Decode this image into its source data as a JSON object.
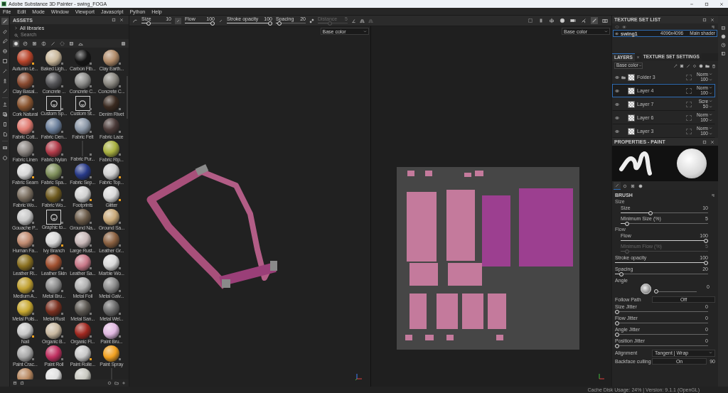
{
  "window": {
    "title": "Adobe Substance 3D Painter - swing_FOGA"
  },
  "menu": [
    "File",
    "Edit",
    "Mode",
    "Window",
    "Viewport",
    "Javascript",
    "Python",
    "Help"
  ],
  "tools": [
    {
      "selected": true
    },
    {
      "selected": false
    },
    {
      "selected": false
    },
    {
      "selected": false
    },
    {
      "selected": false
    },
    {
      "selected": false
    },
    {
      "selected": false
    },
    {
      "selected": false
    },
    {
      "selected": false
    },
    {
      "selected": false
    },
    {
      "selected": false
    },
    {
      "selected": false
    },
    {
      "selected": false
    },
    {
      "selected": false
    }
  ],
  "assets": {
    "title": "ASSETS",
    "library": "All libraries",
    "search_placeholder": "Search",
    "filters": [
      {
        "selected": true
      },
      {
        "selected": false
      },
      {
        "selected": false
      },
      {
        "selected": false
      },
      {
        "selected": false
      },
      {
        "selected": false
      },
      {
        "selected": false
      },
      {
        "selected": false
      }
    ],
    "items": [
      {
        "kind": "sphere",
        "label": "Autumn Le...",
        "color": "#b8442a",
        "smart": true
      },
      {
        "kind": "sphere",
        "label": "Baked Ligh...",
        "color": "#c9b79a",
        "smart": false
      },
      {
        "kind": "sphere",
        "label": "Carbon Fib...",
        "color": "#151515",
        "smart": false
      },
      {
        "kind": "sphere",
        "label": "Clay Earth...",
        "color": "#b08a68",
        "smart": false
      },
      {
        "kind": "sphere",
        "label": "Clay Basal...",
        "color": "#8a4a30",
        "smart": false
      },
      {
        "kind": "sphere",
        "label": "Concrete ...",
        "color": "#555558",
        "smart": false
      },
      {
        "kind": "sphere",
        "label": "Concrete C...",
        "color": "#8c8c8a",
        "smart": false
      },
      {
        "kind": "sphere",
        "label": "Concrete C...",
        "color": "#8a8780",
        "smart": false
      },
      {
        "kind": "sphere",
        "label": "Cork Natural",
        "color": "#8a5530",
        "smart": false
      },
      {
        "kind": "stencil",
        "label": "Custom Sp...",
        "color": "#d0d0d0",
        "smart": false
      },
      {
        "kind": "stencil",
        "label": "Custom St...",
        "color": "#d0d0d0",
        "smart": false
      },
      {
        "kind": "sphere",
        "label": "Denim Rivet",
        "color": "#3a2a20",
        "smart": false
      },
      {
        "kind": "sphere",
        "label": "Fabric Cott...",
        "color": "#e07a70",
        "smart": false
      },
      {
        "kind": "sphere",
        "label": "Fabric Den...",
        "color": "#6a7e9a",
        "smart": false
      },
      {
        "kind": "sphere",
        "label": "Fabric Felt",
        "color": "#8a96a6",
        "smart": false
      },
      {
        "kind": "sphere",
        "label": "Fabric Lace",
        "color": "#4a3a38",
        "smart": false
      },
      {
        "kind": "sphere",
        "label": "Fabric Linen",
        "color": "#8a8480",
        "smart": false
      },
      {
        "kind": "sphere",
        "label": "Fabric Nylon",
        "color": "#b03a48",
        "smart": false
      },
      {
        "kind": "strand",
        "label": "Fabric Pur...",
        "color": "#3a3a3a",
        "smart": false
      },
      {
        "kind": "sphere",
        "label": "Fabric Rip...",
        "color": "#a8b040",
        "smart": false
      },
      {
        "kind": "sphere",
        "label": "Fabric Seam",
        "color": "#d8d8d8",
        "smart": true
      },
      {
        "kind": "sphere",
        "label": "Fabric Spa...",
        "color": "#7e8e5a",
        "smart": false
      },
      {
        "kind": "sphere",
        "label": "Fabric Sep...",
        "color": "#283a88",
        "smart": false
      },
      {
        "kind": "sphere",
        "label": "Fabric Top...",
        "color": "#d0d0d0",
        "smart": true
      },
      {
        "kind": "sphere",
        "label": "Fabric Wo...",
        "color": "#7a6e60",
        "smart": false
      },
      {
        "kind": "sphere",
        "label": "Fabric Wo...",
        "color": "#6e5a20",
        "smart": false
      },
      {
        "kind": "sphere",
        "label": "Footprints",
        "color": "#d0d0d0",
        "smart": true
      },
      {
        "kind": "sphere",
        "label": "Glitter",
        "color": "#d8d8d8",
        "smart": true
      },
      {
        "kind": "sphere",
        "label": "Gouache P...",
        "color": "#c8c8c8",
        "smart": false
      },
      {
        "kind": "stencil",
        "label": "Graphic to...",
        "color": "#d0d0d0",
        "smart": false
      },
      {
        "kind": "sphere",
        "label": "Ground Na...",
        "color": "#6a5a48",
        "smart": false
      },
      {
        "kind": "sphere",
        "label": "Ground Sa...",
        "color": "#c8a878",
        "smart": false
      },
      {
        "kind": "sphere",
        "label": "Human Fa...",
        "color": "#c08a70",
        "smart": false
      },
      {
        "kind": "sphere",
        "label": "Ivy Branch",
        "color": "#d8d8d8",
        "smart": true
      },
      {
        "kind": "sphere",
        "label": "Large Rust...",
        "color": "#c8b8b8",
        "smart": false
      },
      {
        "kind": "sphere",
        "label": "Leather Gr...",
        "color": "#8a6040",
        "smart": false
      },
      {
        "kind": "sphere",
        "label": "Leather Ri...",
        "color": "#8a7020",
        "smart": false
      },
      {
        "kind": "sphere",
        "label": "Leather Skin",
        "color": "#a05030",
        "smart": false
      },
      {
        "kind": "sphere",
        "label": "Leather Sa...",
        "color": "#c87888",
        "smart": false
      },
      {
        "kind": "sphere",
        "label": "Marble Wo...",
        "color": "#d8d8d8",
        "smart": false
      },
      {
        "kind": "sphere",
        "label": "Medium A...",
        "color": "#c0a030",
        "smart": false
      },
      {
        "kind": "sphere",
        "label": "Metal Bru...",
        "color": "#8a8a8a",
        "smart": false
      },
      {
        "kind": "sphere",
        "label": "Metal Foil",
        "color": "#b0b0b0",
        "smart": false
      },
      {
        "kind": "sphere",
        "label": "Metal Galv...",
        "color": "#8a8a8a",
        "smart": false
      },
      {
        "kind": "sphere",
        "label": "Metal Polis...",
        "color": "#c8a830",
        "smart": false
      },
      {
        "kind": "sphere",
        "label": "Metal Rust",
        "color": "#7a3020",
        "smart": false
      },
      {
        "kind": "sphere",
        "label": "Metal San...",
        "color": "#5a5650",
        "smart": false
      },
      {
        "kind": "sphere",
        "label": "Metal Wel...",
        "color": "#6a6a6a",
        "smart": false
      },
      {
        "kind": "sphere",
        "label": "Nail",
        "color": "#c8c8c8",
        "smart": true
      },
      {
        "kind": "sphere",
        "label": "Organic B...",
        "color": "#c8b8a0",
        "smart": false
      },
      {
        "kind": "sphere",
        "label": "Organic Fl...",
        "color": "#a02820",
        "smart": false
      },
      {
        "kind": "sphere",
        "label": "Paint Bru...",
        "color": "#e0b8e0",
        "smart": false
      },
      {
        "kind": "sphere",
        "label": "Paint Crac...",
        "color": "#a8a8a8",
        "smart": false
      },
      {
        "kind": "sphere",
        "label": "Paint Roll",
        "color": "#c03060",
        "smart": false
      },
      {
        "kind": "sphere",
        "label": "Paint Rolle...",
        "color": "#c8c8c8",
        "smart": true
      },
      {
        "kind": "sphere",
        "label": "Paint Spray",
        "color": "#f0a020",
        "smart": false
      },
      {
        "kind": "sphere",
        "color": "#b88860"
      },
      {
        "kind": "sphere",
        "color": "#e0e0e0"
      },
      {
        "kind": "sphere",
        "color": "#c8c8c0"
      },
      {
        "kind": "strand",
        "color": "#3a3a3a"
      }
    ]
  },
  "toolbar": {
    "sliders": [
      {
        "label": "Size",
        "value": "10",
        "level": 0.2,
        "disabled": false
      },
      {
        "label": "Flow",
        "value": "100",
        "level": 1,
        "disabled": false
      },
      {
        "label": "Stroke opacity",
        "value": "100",
        "level": 1,
        "disabled": false
      },
      {
        "label": "Spacing",
        "value": "20",
        "level": 0.05,
        "disabled": false
      },
      {
        "label": "Distance",
        "value": "5",
        "level": 0.4,
        "disabled": true
      }
    ]
  },
  "viewports": [
    {
      "channel": "Base color"
    },
    {
      "channel": "Base color"
    }
  ],
  "texture_set_list": {
    "title": "TEXTURE SET LIST",
    "rows": [
      {
        "name": "swing1",
        "size": "4096x4096",
        "shader": "Main shader",
        "selected": true
      }
    ]
  },
  "layers": {
    "tabs": [
      {
        "label": "LAYERS",
        "selected": true
      },
      {
        "label": "TEXTURE SET SETTINGS",
        "selected": false
      }
    ],
    "channel": "Base color",
    "rows": [
      {
        "kind": "folder",
        "name": "Folder 3",
        "blend": "Norm",
        "opacity": "100",
        "selected": false
      },
      {
        "kind": "paint",
        "name": "Layer 4",
        "blend": "Norm",
        "opacity": "100",
        "selected": true
      },
      {
        "kind": "paint",
        "name": "Layer 7",
        "blend": "Scre",
        "opacity": "50",
        "selected": false
      },
      {
        "kind": "paint",
        "name": "Layer 6",
        "blend": "Norm",
        "opacity": "100",
        "selected": false
      },
      {
        "kind": "paint",
        "name": "Layer 3",
        "blend": "Norm",
        "opacity": "100",
        "selected": false
      }
    ]
  },
  "properties": {
    "title": "PROPERTIES - PAINT",
    "tabs": [
      {
        "selected": true
      },
      {
        "selected": false
      },
      {
        "selected": false
      },
      {
        "selected": false
      }
    ],
    "section": "BRUSH",
    "params": [
      {
        "kind": "group",
        "label": "Size",
        "children": [
          {
            "kind": "slider",
            "label": "Size",
            "value": "10",
            "level": 0.33,
            "disabled": false
          },
          {
            "kind": "slider",
            "label": "Minimum Size (%)",
            "value": "5",
            "level": 0.05,
            "disabled": false
          }
        ]
      },
      {
        "kind": "group",
        "label": "Flow",
        "children": [
          {
            "kind": "slider",
            "label": "Flow",
            "value": "100",
            "level": 1,
            "disabled": false
          },
          {
            "kind": "slider",
            "label": "Minimum Flow (%)",
            "value": "5",
            "level": 0.05,
            "disabled": true
          }
        ]
      },
      {
        "kind": "slider",
        "label": "Stroke opacity",
        "value": "100",
        "level": 1,
        "disabled": false
      },
      {
        "kind": "slider",
        "label": "Spacing",
        "value": "20",
        "level": 0.05,
        "disabled": false
      },
      {
        "kind": "angle",
        "label": "Angle",
        "value": "0",
        "level": 0
      },
      {
        "kind": "toggle",
        "label": "Follow Path",
        "value": "Off"
      },
      {
        "kind": "slider",
        "label": "Size Jitter",
        "value": "0",
        "level": 0,
        "disabled": false
      },
      {
        "kind": "slider",
        "label": "Flow Jitter",
        "value": "0",
        "level": 0,
        "disabled": false
      },
      {
        "kind": "slider",
        "label": "Angle Jitter",
        "value": "0",
        "level": 0,
        "disabled": false
      },
      {
        "kind": "slider",
        "label": "Position Jitter",
        "value": "0",
        "level": 0,
        "disabled": false
      },
      {
        "kind": "select",
        "label": "Alignment",
        "value": "Tangent | Wrap"
      },
      {
        "kind": "toggle",
        "label": "Backface culling",
        "value": "On",
        "reading": "90"
      }
    ]
  },
  "status_bar": "Cache Disk Usage: 24% | Version: 9.1.1 (OpenGL)"
}
